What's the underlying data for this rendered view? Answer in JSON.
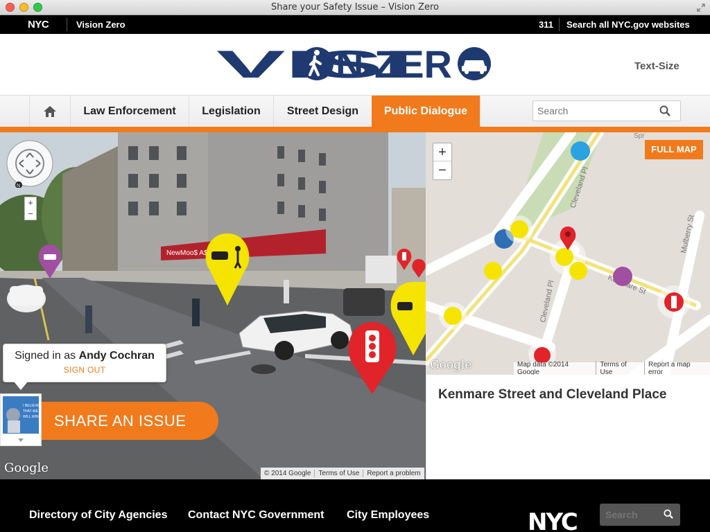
{
  "window": {
    "title": "Share your Safety Issue – Vision Zero"
  },
  "topbar": {
    "logo": "NYC",
    "site": "Vision Zero",
    "link_311": "311",
    "search_all": "Search all NYC.gov websites"
  },
  "header": {
    "logo_text": "VISION ZERO",
    "text_size": "Text-Size"
  },
  "nav": {
    "items": [
      {
        "label": "Law Enforcement"
      },
      {
        "label": "Legislation"
      },
      {
        "label": "Street Design"
      },
      {
        "label": "Public Dialogue"
      }
    ],
    "search_placeholder": "Search"
  },
  "streetview": {
    "google_mark": "Google",
    "footer": {
      "copyright": "© 2014 Google",
      "terms": "Terms of Use",
      "report": "Report a problem"
    },
    "compass_label": "N"
  },
  "user": {
    "signed_in_prefix": "Signed in as",
    "name": "Andy Cochran",
    "sign_out": "SIGN OUT",
    "avatar_text": "I BELIEVE THAT WE WILL WIN"
  },
  "share_button": "SHARE AN ISSUE",
  "storefront": {
    "shop_sign": "NewMoo$ A$ll"
  },
  "map": {
    "full_map": "FULL MAP",
    "google_mark": "Google",
    "street_labels": [
      "Cleveland Pl",
      "Kenmare St",
      "Mulberry St",
      "Spr",
      "Cleveland Pl"
    ],
    "footer": {
      "data": "Map data ©2014 Google",
      "terms": "Terms of Use",
      "report": "Report a map error"
    }
  },
  "location": {
    "title": "Kenmare Street and Cleveland Place"
  },
  "footer": {
    "links": [
      "Directory of City Agencies",
      "Contact NYC Government",
      "City Employees"
    ],
    "logo": "NYC",
    "search_placeholder": "Search"
  },
  "colors": {
    "orange": "#f07a1c",
    "yellow_marker": "#f5e400",
    "red_marker": "#e0242a",
    "purple_marker": "#a14fa0",
    "blue_marker": "#2f6fb3",
    "navy_logo": "#1f3a70"
  }
}
